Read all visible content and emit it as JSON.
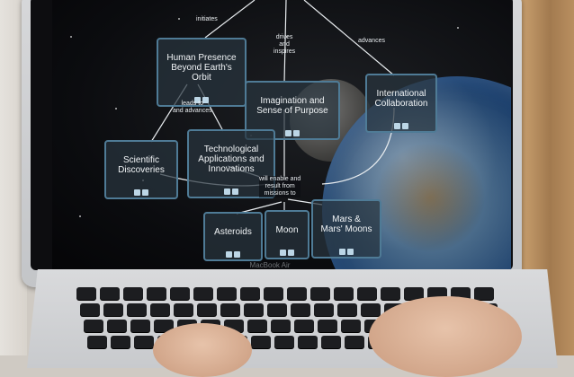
{
  "device": {
    "brand_label": "MacBook Air"
  },
  "mindmap": {
    "nodes": [
      {
        "id": "presence",
        "text": "Human Presence\nBeyond Earth's\nOrbit"
      },
      {
        "id": "imagination",
        "text": "Imagination and\nSense of Purpose"
      },
      {
        "id": "intl",
        "text": "International\nCollaboration"
      },
      {
        "id": "science",
        "text": "Scientific\nDiscoveries"
      },
      {
        "id": "tech",
        "text": "Technological\nApplications and\nInnovations"
      },
      {
        "id": "asteroids",
        "text": "Asteroids"
      },
      {
        "id": "moon",
        "text": "Moon"
      },
      {
        "id": "mars",
        "text": "Mars &\nMars' Moons"
      }
    ],
    "edge_labels": {
      "initiates": "initiates",
      "drives": "drives\nand\ninspires",
      "advances": "advances",
      "leads": "leads to\nand advances",
      "enable": "will enable and\nresult from\nmissions to"
    }
  }
}
